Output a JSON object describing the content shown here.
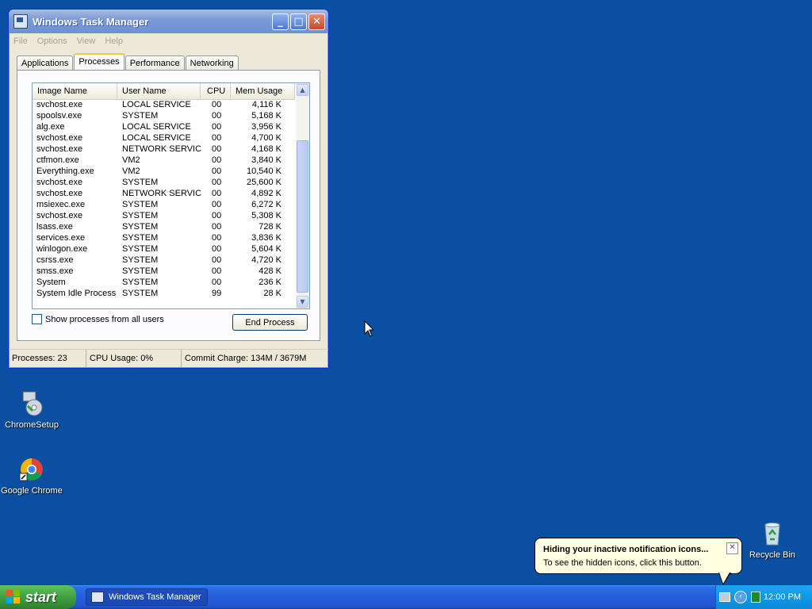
{
  "window": {
    "title": "Windows Task Manager",
    "menu": [
      "File",
      "Options",
      "View",
      "Help"
    ],
    "tabs": [
      "Applications",
      "Processes",
      "Performance",
      "Networking"
    ],
    "active_tab": "Processes"
  },
  "processes": {
    "columns": [
      "Image Name",
      "User Name",
      "CPU",
      "Mem Usage"
    ],
    "rows": [
      [
        "svchost.exe",
        "LOCAL SERVICE",
        "00",
        "4,116 K"
      ],
      [
        "spoolsv.exe",
        "SYSTEM",
        "00",
        "5,168 K"
      ],
      [
        "alg.exe",
        "LOCAL SERVICE",
        "00",
        "3,956 K"
      ],
      [
        "svchost.exe",
        "LOCAL SERVICE",
        "00",
        "4,700 K"
      ],
      [
        "svchost.exe",
        "NETWORK SERVICE",
        "00",
        "4,168 K"
      ],
      [
        "ctfmon.exe",
        "VM2",
        "00",
        "3,840 K"
      ],
      [
        "Everything.exe",
        "VM2",
        "00",
        "10,540 K"
      ],
      [
        "svchost.exe",
        "SYSTEM",
        "00",
        "25,600 K"
      ],
      [
        "svchost.exe",
        "NETWORK SERVICE",
        "00",
        "4,892 K"
      ],
      [
        "msiexec.exe",
        "SYSTEM",
        "00",
        "6,272 K"
      ],
      [
        "svchost.exe",
        "SYSTEM",
        "00",
        "5,308 K"
      ],
      [
        "lsass.exe",
        "SYSTEM",
        "00",
        "728 K"
      ],
      [
        "services.exe",
        "SYSTEM",
        "00",
        "3,836 K"
      ],
      [
        "winlogon.exe",
        "SYSTEM",
        "00",
        "5,604 K"
      ],
      [
        "csrss.exe",
        "SYSTEM",
        "00",
        "4,720 K"
      ],
      [
        "smss.exe",
        "SYSTEM",
        "00",
        "428 K"
      ],
      [
        "System",
        "SYSTEM",
        "00",
        "236 K"
      ],
      [
        "System Idle Process",
        "SYSTEM",
        "99",
        "28 K"
      ]
    ],
    "show_all_label": "Show processes from all users",
    "end_process_label": "End Process"
  },
  "status": {
    "processes": "Processes: 23",
    "cpu": "CPU Usage: 0%",
    "commit": "Commit Charge: 134M / 3679M"
  },
  "desktop_icons": {
    "chrome_setup": "ChromeSetup",
    "google_chrome": "Google Chrome",
    "recycle_bin": "Recycle Bin"
  },
  "taskbar": {
    "start_label": "start",
    "task_button": "Windows Task Manager",
    "clock": "12:00 PM"
  },
  "balloon": {
    "title": "Hiding your inactive notification icons...",
    "body": "To see the hidden icons, click this button."
  }
}
